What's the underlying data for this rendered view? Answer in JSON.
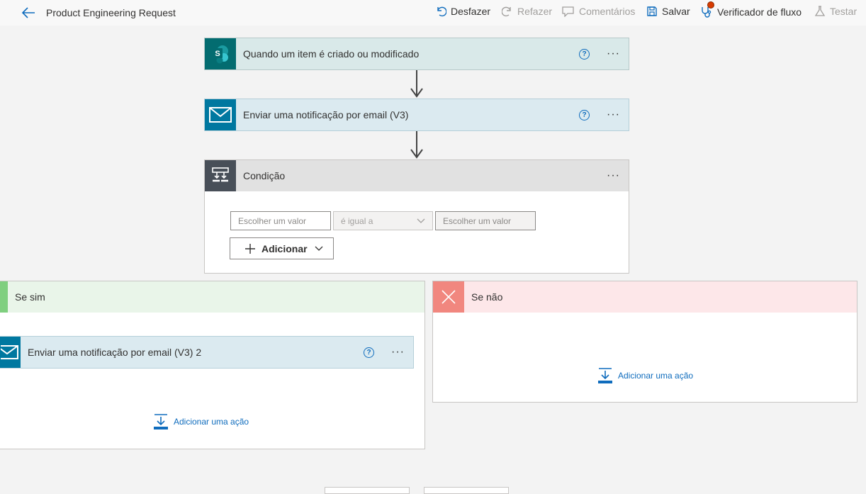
{
  "header": {
    "title": "Product Engineering Request",
    "undo": "Desfazer",
    "redo": "Refazer",
    "comments": "Comentários",
    "save": "Salvar",
    "flow_checker": "Verificador de fluxo",
    "test": "Testar"
  },
  "trigger": {
    "title": "Quando um item é criado ou modificado",
    "more": "···",
    "help": "?"
  },
  "email_action": {
    "title": "Enviar uma notificação por email (V3)",
    "more": "···",
    "help": "?"
  },
  "condition": {
    "title": "Condição",
    "more": "···",
    "left_placeholder": "Escolher um valor",
    "operator": "é igual a",
    "right_placeholder": "Escolher um valor",
    "add_label": "Adicionar"
  },
  "branch_yes": {
    "title": "Se sim",
    "action_title": "Enviar uma notificação por email (V3) 2",
    "more": "···",
    "help": "?",
    "add_action": "Adicionar uma ação"
  },
  "branch_no": {
    "title": "Se não",
    "add_action": "Adicionar uma ação"
  },
  "colors": {
    "trigger_head": "#d9e9e9",
    "email_head": "#dbeaf0",
    "condition_head": "#e1e1e1",
    "yes_head": "#e9f5e9",
    "no_head": "#fde7e9",
    "accent": "#0f6cbd"
  }
}
